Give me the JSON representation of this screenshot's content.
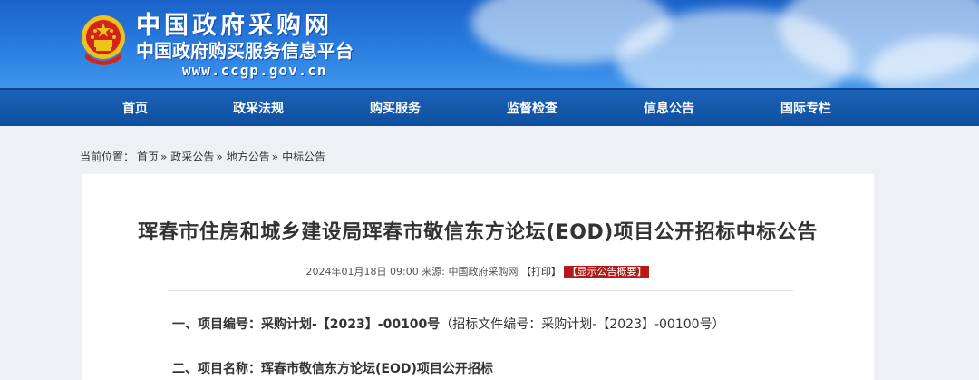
{
  "header": {
    "site_name": "中国政府采购网",
    "site_subtitle": "中国政府购买服务信息平台",
    "site_url": "www.ccgp.gov.cn",
    "emblem_icon": "national-emblem-icon",
    "colors": {
      "banner": "#2a7ee0",
      "nav": "#1559ad",
      "emblem_red": "#d2231c",
      "emblem_gold": "#f0c21a"
    }
  },
  "nav": {
    "items": [
      {
        "label": "首页"
      },
      {
        "label": "政采法规"
      },
      {
        "label": "购买服务"
      },
      {
        "label": "监督检查"
      },
      {
        "label": "信息公告"
      },
      {
        "label": "国际专栏"
      }
    ]
  },
  "breadcrumb": {
    "prefix": "当前位置：",
    "items": [
      "首页",
      "政采公告",
      "地方公告",
      "中标公告"
    ],
    "separator": "»"
  },
  "article": {
    "title": "珲春市住房和城乡建设局珲春市敬信东方论坛(EOD)项目公开招标中标公告",
    "meta_date": "2024年01月18日 09:00",
    "meta_source_label": "来源:",
    "meta_source": "中国政府采购网",
    "print_label": "【打印】",
    "summary_label": "【显示公告概要】",
    "sections": [
      {
        "heading": "一、项目编号：",
        "value": "采购计划-【2023】-00100号",
        "note": "（招标文件编号：采购计划-【2023】-00100号）"
      },
      {
        "heading": "二、项目名称：",
        "value": "珲春市敬信东方论坛(EOD)项目公开招标",
        "note": ""
      }
    ]
  }
}
